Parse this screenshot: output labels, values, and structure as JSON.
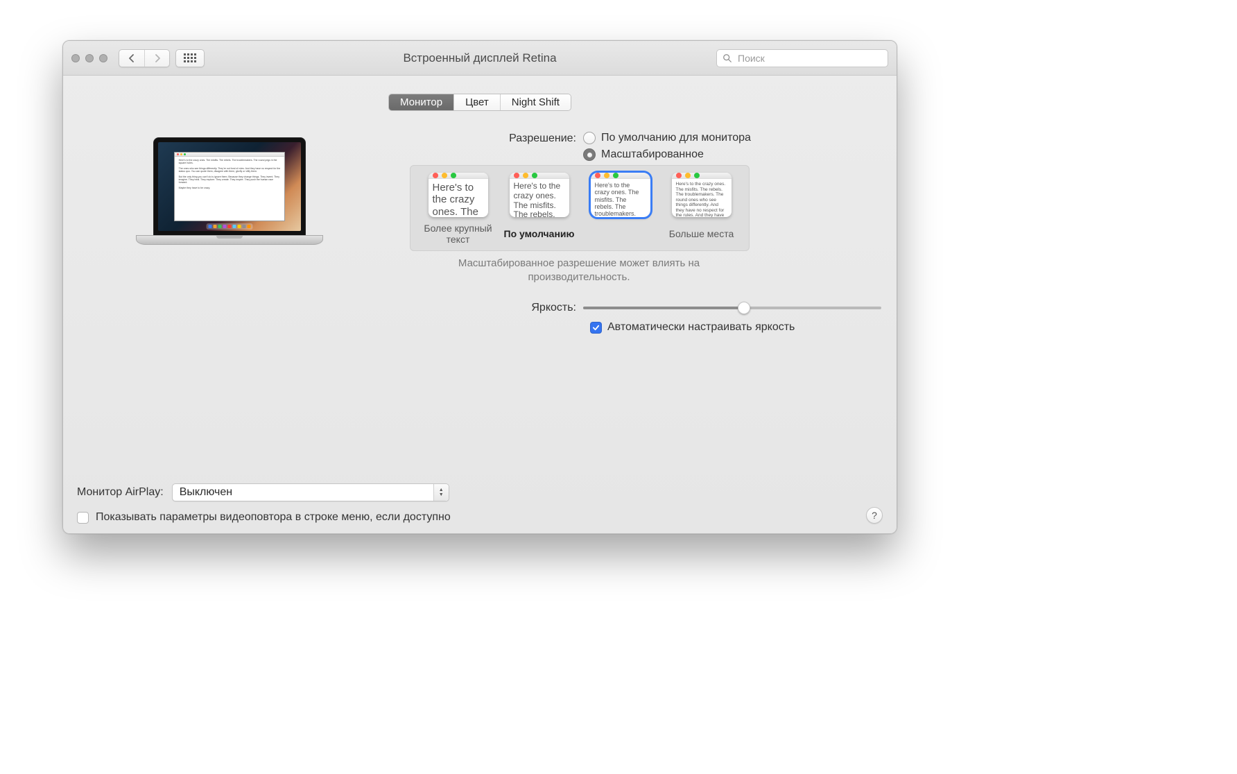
{
  "window": {
    "title": "Встроенный дисплей Retina"
  },
  "search": {
    "placeholder": "Поиск"
  },
  "tabs": {
    "display": "Монитор",
    "color": "Цвет",
    "nightshift": "Night Shift"
  },
  "resolution": {
    "label": "Разрешение:",
    "default": "По умолчанию для монитора",
    "scaled": "Масштабированное",
    "selected": "scaled"
  },
  "scale_options": {
    "sample": "Here's to the crazy ones. The misfits. The rebels. The troublemakers. The round ones who see things differently. And they have no respect for the rules. And they have no can quote them, disagree them. About the only thing Because they change th",
    "larger_text": "Более крупный текст",
    "default": "По умолчанию",
    "more_space": "Больше места",
    "perf_note": "Масштабированное разрешение может влиять на производительность."
  },
  "brightness": {
    "label": "Яркость:",
    "auto": "Автоматически настраивать яркость",
    "auto_checked": true,
    "value_percent": 54
  },
  "airplay": {
    "label": "Монитор AirPlay:",
    "value": "Выключен"
  },
  "mirror": {
    "label": "Показывать параметры видеоповтора в строке меню, если доступно",
    "checked": false
  },
  "help": "?"
}
